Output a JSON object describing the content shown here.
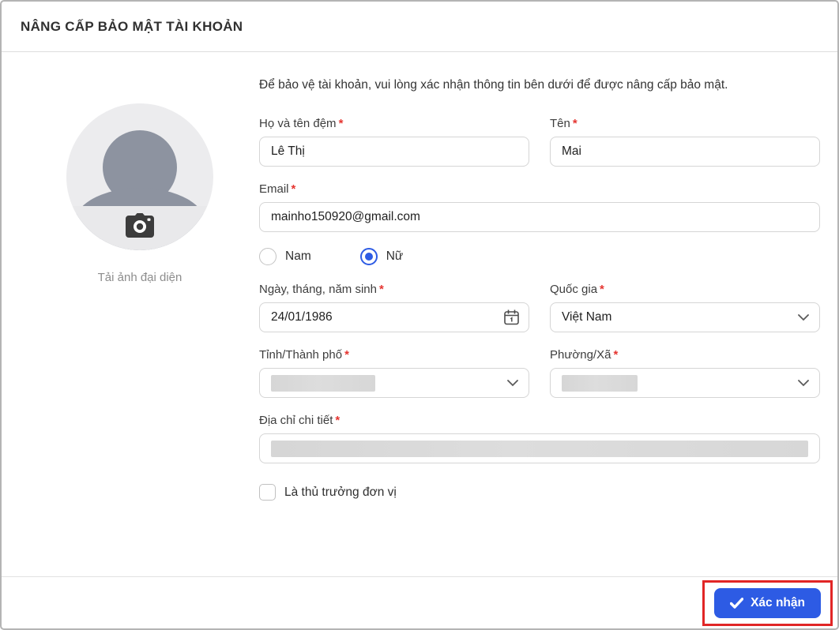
{
  "dialog": {
    "title": "NÂNG CẤP BẢO MẬT TÀI KHOẢN",
    "description": "Để bảo vệ tài khoản, vui lòng xác nhận thông tin bên dưới để được nâng cấp bảo mật."
  },
  "avatar": {
    "caption": "Tải ảnh đại diện",
    "icon": "camera-icon"
  },
  "form": {
    "required_marker": "*",
    "middle_name": {
      "label": "Họ và tên đệm",
      "value": "Lê Thị",
      "required": true
    },
    "first_name": {
      "label": "Tên",
      "value": "Mai",
      "required": true
    },
    "email": {
      "label": "Email",
      "value": "mainho150920@gmail.com",
      "required": true
    },
    "gender": {
      "options": [
        {
          "label": "Nam",
          "selected": false
        },
        {
          "label": "Nữ",
          "selected": true
        }
      ]
    },
    "dob": {
      "label": "Ngày, tháng, năm sinh",
      "value": "24/01/1986",
      "required": true,
      "icon": "calendar-icon"
    },
    "country": {
      "label": "Quốc gia",
      "value": "Việt Nam",
      "required": true
    },
    "province": {
      "label": "Tỉnh/Thành phố",
      "value": "",
      "redacted": true,
      "required": true
    },
    "ward": {
      "label": "Phường/Xã",
      "value": "",
      "redacted": true,
      "required": true
    },
    "address": {
      "label": "Địa chỉ chi tiết",
      "value": "",
      "redacted": true,
      "required": true
    },
    "is_unit_head": {
      "label": "Là thủ trưởng đơn vị",
      "checked": false
    }
  },
  "footer": {
    "confirm_label": "Xác nhận",
    "confirm_icon": "check-icon"
  },
  "colors": {
    "accent_blue": "#2d5be4",
    "required_red": "#e53530",
    "highlight_red": "#e12626",
    "border_gray": "#d5d5d5"
  }
}
